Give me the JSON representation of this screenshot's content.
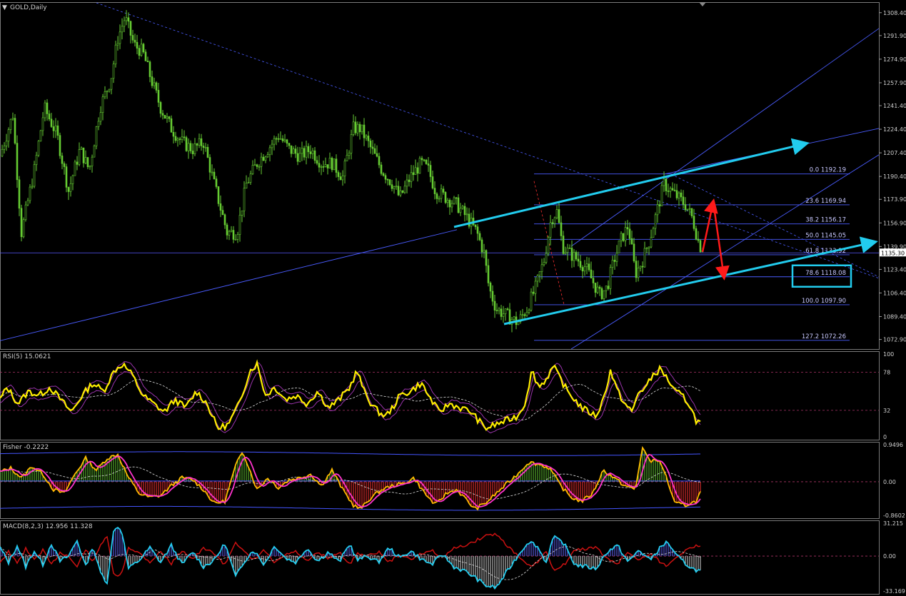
{
  "chart_data": {
    "type": "line",
    "symbol": "GOLD,Daily",
    "main": {
      "price_range": [
        1066,
        1316
      ],
      "y_ticks": [
        "1308.40",
        "1291.90",
        "1274.90",
        "1257.90",
        "1241.40",
        "1224.40",
        "1207.40",
        "1190.40",
        "1173.90",
        "1156.90",
        "1139.90",
        "1123.40",
        "1106.40",
        "1089.40",
        "1072.90"
      ],
      "current_price": "1135.30",
      "fib_levels": [
        {
          "label": "0.0  1192.19",
          "price": 1192.19
        },
        {
          "label": "23.6  1169.94",
          "price": 1169.94
        },
        {
          "label": "38.2  1156.17",
          "price": 1156.17
        },
        {
          "label": "50.0  1145.05",
          "price": 1145.05
        },
        {
          "label": "61.8  1133.92",
          "price": 1133.92
        },
        {
          "label": "78.6  1118.08",
          "price": 1118.08
        },
        {
          "label": "100.0  1097.90",
          "price": 1097.9
        },
        {
          "label": "127.2  1072.26",
          "price": 1072.26
        }
      ],
      "close_anchors": [
        [
          0,
          1205
        ],
        [
          18,
          1235
        ],
        [
          30,
          1150
        ],
        [
          48,
          1195
        ],
        [
          62,
          1240
        ],
        [
          80,
          1220
        ],
        [
          96,
          1180
        ],
        [
          112,
          1210
        ],
        [
          125,
          1195
        ],
        [
          140,
          1240
        ],
        [
          155,
          1260
        ],
        [
          165,
          1290
        ],
        [
          175,
          1305
        ],
        [
          188,
          1285
        ],
        [
          200,
          1280
        ],
        [
          212,
          1260
        ],
        [
          225,
          1240
        ],
        [
          240,
          1225
        ],
        [
          255,
          1215
        ],
        [
          270,
          1210
        ],
        [
          285,
          1215
        ],
        [
          300,
          1185
        ],
        [
          318,
          1150
        ],
        [
          332,
          1150
        ],
        [
          345,
          1185
        ],
        [
          360,
          1200
        ],
        [
          375,
          1210
        ],
        [
          390,
          1220
        ],
        [
          405,
          1210
        ],
        [
          420,
          1205
        ],
        [
          435,
          1210
        ],
        [
          450,
          1200
        ],
        [
          465,
          1200
        ],
        [
          480,
          1190
        ],
        [
          495,
          1225
        ],
        [
          505,
          1225
        ],
        [
          520,
          1210
        ],
        [
          535,
          1195
        ],
        [
          550,
          1185
        ],
        [
          560,
          1175
        ],
        [
          575,
          1190
        ],
        [
          590,
          1200
        ],
        [
          600,
          1195
        ],
        [
          610,
          1180
        ],
        [
          625,
          1175
        ],
        [
          640,
          1170
        ],
        [
          655,
          1160
        ],
        [
          668,
          1150
        ],
        [
          678,
          1135
        ],
        [
          685,
          1110
        ],
        [
          695,
          1095
        ],
        [
          710,
          1090
        ],
        [
          725,
          1085
        ],
        [
          738,
          1095
        ],
        [
          750,
          1110
        ],
        [
          762,
          1130
        ],
        [
          772,
          1160
        ],
        [
          780,
          1165
        ],
        [
          788,
          1140
        ],
        [
          798,
          1135
        ],
        [
          810,
          1130
        ],
        [
          820,
          1125
        ],
        [
          830,
          1115
        ],
        [
          840,
          1105
        ],
        [
          850,
          1110
        ],
        [
          860,
          1130
        ],
        [
          870,
          1145
        ],
        [
          880,
          1155
        ],
        [
          890,
          1120
        ],
        [
          900,
          1130
        ],
        [
          910,
          1145
        ],
        [
          920,
          1165
        ],
        [
          930,
          1185
        ],
        [
          940,
          1180
        ],
        [
          950,
          1175
        ],
        [
          960,
          1170
        ],
        [
          970,
          1160
        ],
        [
          980,
          1140
        ]
      ]
    },
    "rsi": {
      "label": "RSI(5) 15.0621",
      "range": [
        0,
        100
      ],
      "y_ticks": [
        "100",
        "78",
        "32",
        "0"
      ],
      "levels": [
        78,
        32
      ],
      "anchors": [
        [
          0,
          45
        ],
        [
          10,
          60
        ],
        [
          25,
          40
        ],
        [
          40,
          55
        ],
        [
          55,
          50
        ],
        [
          70,
          60
        ],
        [
          85,
          45
        ],
        [
          100,
          30
        ],
        [
          115,
          50
        ],
        [
          130,
          65
        ],
        [
          145,
          55
        ],
        [
          160,
          80
        ],
        [
          172,
          88
        ],
        [
          185,
          75
        ],
        [
          200,
          50
        ],
        [
          215,
          40
        ],
        [
          230,
          30
        ],
        [
          245,
          45
        ],
        [
          260,
          35
        ],
        [
          275,
          55
        ],
        [
          290,
          40
        ],
        [
          305,
          10
        ],
        [
          320,
          15
        ],
        [
          335,
          40
        ],
        [
          350,
          80
        ],
        [
          360,
          88
        ],
        [
          372,
          50
        ],
        [
          385,
          60
        ],
        [
          400,
          45
        ],
        [
          415,
          50
        ],
        [
          430,
          40
        ],
        [
          445,
          55
        ],
        [
          460,
          35
        ],
        [
          475,
          45
        ],
        [
          490,
          60
        ],
        [
          500,
          80
        ],
        [
          510,
          55
        ],
        [
          520,
          40
        ],
        [
          530,
          30
        ],
        [
          540,
          25
        ],
        [
          550,
          35
        ],
        [
          560,
          50
        ],
        [
          575,
          55
        ],
        [
          590,
          65
        ],
        [
          600,
          50
        ],
        [
          615,
          30
        ],
        [
          630,
          40
        ],
        [
          645,
          35
        ],
        [
          660,
          30
        ],
        [
          670,
          20
        ],
        [
          680,
          10
        ],
        [
          695,
          15
        ],
        [
          710,
          20
        ],
        [
          725,
          25
        ],
        [
          735,
          40
        ],
        [
          745,
          80
        ],
        [
          755,
          60
        ],
        [
          765,
          70
        ],
        [
          775,
          85
        ],
        [
          785,
          70
        ],
        [
          795,
          55
        ],
        [
          805,
          45
        ],
        [
          815,
          35
        ],
        [
          825,
          30
        ],
        [
          835,
          25
        ],
        [
          845,
          45
        ],
        [
          855,
          80
        ],
        [
          865,
          55
        ],
        [
          875,
          40
        ],
        [
          885,
          30
        ],
        [
          895,
          55
        ],
        [
          905,
          60
        ],
        [
          915,
          75
        ],
        [
          925,
          82
        ],
        [
          935,
          70
        ],
        [
          945,
          55
        ],
        [
          955,
          50
        ],
        [
          965,
          40
        ],
        [
          975,
          20
        ],
        [
          983,
          15
        ]
      ]
    },
    "fisher": {
      "label": "Fisher -0.2222",
      "range": [
        -0.86,
        0.95
      ],
      "y_ticks": [
        "0.9496",
        "0.00",
        "-0.8602"
      ],
      "anchors": [
        [
          0,
          0.25
        ],
        [
          15,
          0.35
        ],
        [
          30,
          0.1
        ],
        [
          45,
          0.4
        ],
        [
          60,
          0.2
        ],
        [
          75,
          -0.2
        ],
        [
          90,
          -0.3
        ],
        [
          105,
          0.2
        ],
        [
          120,
          0.6
        ],
        [
          135,
          0.3
        ],
        [
          150,
          0.6
        ],
        [
          165,
          0.7
        ],
        [
          180,
          0.1
        ],
        [
          195,
          -0.3
        ],
        [
          210,
          -0.4
        ],
        [
          225,
          -0.35
        ],
        [
          240,
          -0.1
        ],
        [
          255,
          0.1
        ],
        [
          270,
          0.05
        ],
        [
          285,
          -0.2
        ],
        [
          300,
          -0.55
        ],
        [
          315,
          -0.5
        ],
        [
          330,
          0.4
        ],
        [
          340,
          0.8
        ],
        [
          350,
          0.3
        ],
        [
          360,
          -0.2
        ],
        [
          375,
          0.1
        ],
        [
          390,
          -0.15
        ],
        [
          405,
          0.05
        ],
        [
          420,
          0.1
        ],
        [
          435,
          0.2
        ],
        [
          450,
          -0.1
        ],
        [
          465,
          0.3
        ],
        [
          480,
          -0.2
        ],
        [
          495,
          -0.6
        ],
        [
          505,
          -0.7
        ],
        [
          520,
          -0.4
        ],
        [
          535,
          -0.2
        ],
        [
          550,
          -0.1
        ],
        [
          565,
          -0.05
        ],
        [
          580,
          0.1
        ],
        [
          595,
          -0.3
        ],
        [
          610,
          -0.6
        ],
        [
          625,
          -0.3
        ],
        [
          640,
          -0.2
        ],
        [
          655,
          -0.5
        ],
        [
          665,
          -0.7
        ],
        [
          680,
          -0.55
        ],
        [
          695,
          -0.3
        ],
        [
          710,
          -0.05
        ],
        [
          725,
          0.2
        ],
        [
          740,
          0.5
        ],
        [
          755,
          0.45
        ],
        [
          770,
          0.35
        ],
        [
          785,
          -0.1
        ],
        [
          800,
          -0.4
        ],
        [
          815,
          -0.5
        ],
        [
          830,
          -0.3
        ],
        [
          845,
          0.3
        ],
        [
          860,
          0.1
        ],
        [
          875,
          -0.1
        ],
        [
          890,
          -0.2
        ],
        [
          900,
          0.9
        ],
        [
          910,
          0.5
        ],
        [
          920,
          0.6
        ],
        [
          930,
          0.3
        ],
        [
          945,
          -0.55
        ],
        [
          960,
          -0.6
        ],
        [
          975,
          -0.5
        ],
        [
          983,
          -0.2
        ]
      ]
    },
    "macd": {
      "label": "MACD(8,2,3) 12.956 11.328",
      "range": [
        -33.169,
        31.215
      ],
      "y_ticks": [
        "31.215",
        "0.00",
        "-33.169"
      ],
      "anchors": [
        [
          0,
          8
        ],
        [
          12,
          -6
        ],
        [
          24,
          10
        ],
        [
          36,
          -10
        ],
        [
          48,
          5
        ],
        [
          60,
          -8
        ],
        [
          72,
          12
        ],
        [
          84,
          -5
        ],
        [
          96,
          0
        ],
        [
          108,
          15
        ],
        [
          120,
          -10
        ],
        [
          130,
          10
        ],
        [
          140,
          -15
        ],
        [
          150,
          -25
        ],
        [
          160,
          28
        ],
        [
          170,
          26
        ],
        [
          180,
          -12
        ],
        [
          195,
          -4
        ],
        [
          210,
          8
        ],
        [
          225,
          -6
        ],
        [
          240,
          10
        ],
        [
          255,
          -8
        ],
        [
          270,
          4
        ],
        [
          285,
          -10
        ],
        [
          300,
          -4
        ],
        [
          315,
          12
        ],
        [
          330,
          -20
        ],
        [
          342,
          -5
        ],
        [
          355,
          6
        ],
        [
          370,
          -8
        ],
        [
          385,
          10
        ],
        [
          400,
          -2
        ],
        [
          415,
          -6
        ],
        [
          430,
          8
        ],
        [
          445,
          -5
        ],
        [
          460,
          4
        ],
        [
          475,
          -6
        ],
        [
          490,
          12
        ],
        [
          500,
          -4
        ],
        [
          515,
          0
        ],
        [
          530,
          -6
        ],
        [
          545,
          8
        ],
        [
          560,
          -2
        ],
        [
          575,
          5
        ],
        [
          590,
          -3
        ],
        [
          605,
          -8
        ],
        [
          620,
          2
        ],
        [
          635,
          -10
        ],
        [
          650,
          -14
        ],
        [
          665,
          -20
        ],
        [
          680,
          -28
        ],
        [
          695,
          -30
        ],
        [
          710,
          -15
        ],
        [
          725,
          0
        ],
        [
          740,
          14
        ],
        [
          752,
          10
        ],
        [
          765,
          -6
        ],
        [
          775,
          18
        ],
        [
          790,
          12
        ],
        [
          805,
          -8
        ],
        [
          820,
          -10
        ],
        [
          835,
          -12
        ],
        [
          850,
          4
        ],
        [
          865,
          10
        ],
        [
          880,
          -6
        ],
        [
          895,
          6
        ],
        [
          910,
          -4
        ],
        [
          925,
          8
        ],
        [
          935,
          14
        ],
        [
          945,
          2
        ],
        [
          958,
          -6
        ],
        [
          970,
          -12
        ],
        [
          983,
          -15
        ]
      ]
    },
    "overlays": {
      "cyan_channel_upper": [
        [
          636,
          1154
        ],
        [
          1128,
          1214
        ]
      ],
      "cyan_channel_lower": [
        [
          706,
          1084
        ],
        [
          1224,
          1143
        ]
      ],
      "red_arrow_path": [
        [
          984,
          1136
        ],
        [
          999,
          1172
        ],
        [
          1014,
          1118
        ]
      ],
      "cyan_box_label": "78.6  1118.08"
    }
  }
}
